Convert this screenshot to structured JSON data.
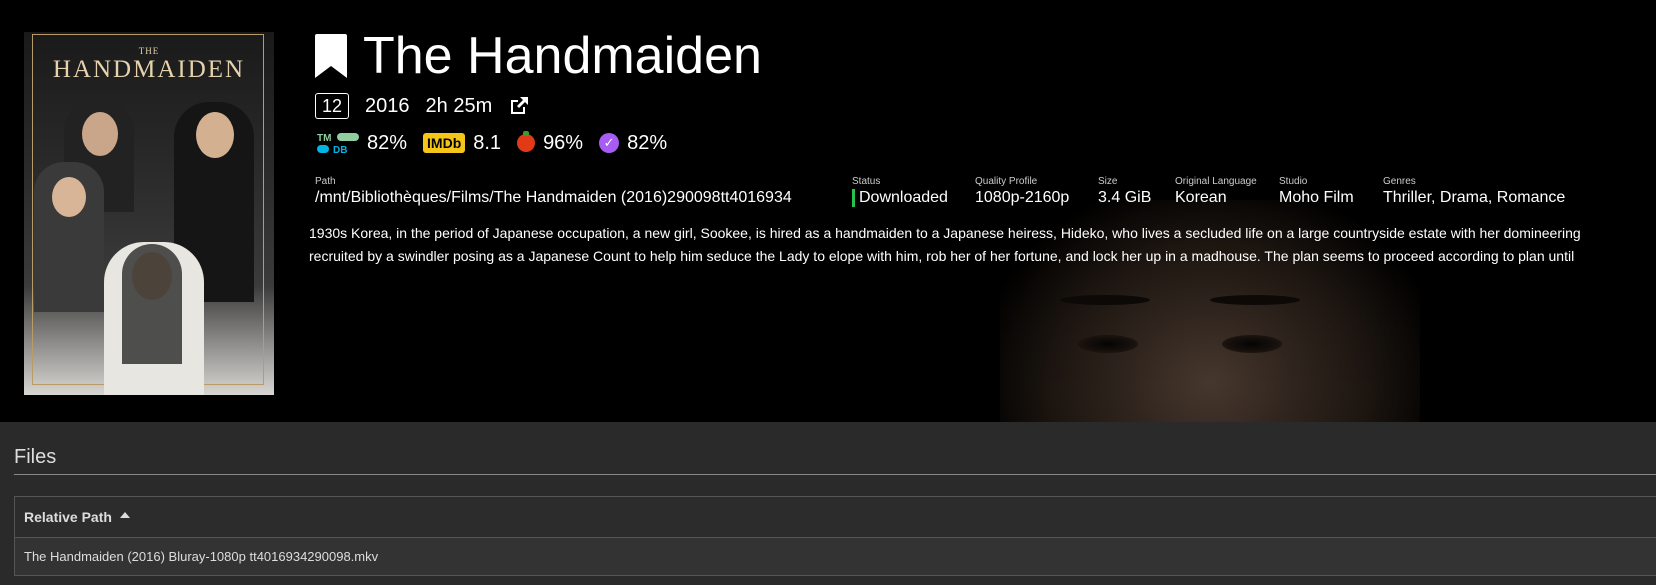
{
  "poster": {
    "small_title": "THE",
    "title": "HANDMAIDEN"
  },
  "movie": {
    "title": "The Handmaiden",
    "certification": "12",
    "year": "2016",
    "runtime": "2h 25m"
  },
  "ratings": {
    "tmdb_label": "TMDB",
    "tmdb": "82%",
    "imdb_label": "IMDb",
    "imdb": "8.1",
    "rotten": "96%",
    "trakt": "82%"
  },
  "details": {
    "path_label": "Path",
    "path": "/mnt/Bibliothèques/Films/The Handmaiden (2016)290098tt4016934",
    "status_label": "Status",
    "status": "Downloaded",
    "quality_label": "Quality Profile",
    "quality": "1080p-2160p",
    "size_label": "Size",
    "size": "3.4 GiB",
    "language_label": "Original Language",
    "language": "Korean",
    "studio_label": "Studio",
    "studio": "Moho Film",
    "genres_label": "Genres",
    "genres": "Thriller, Drama, Romance"
  },
  "overview": {
    "line1": "1930s Korea, in the period of Japanese occupation, a new girl, Sookee, is hired as a handmaiden to a Japanese heiress, Hideko, who lives a secluded life on a large countryside estate with her domineering",
    "line2": "recruited by a swindler posing as a Japanese Count to help him seduce the Lady to elope with him, rob her of her fortune, and lock her up in a madhouse. The plan seems to proceed according to plan until"
  },
  "files": {
    "title": "Files",
    "column_relative_path": "Relative Path",
    "rows": [
      {
        "relative_path": "The Handmaiden (2016) Bluray-1080p tt4016934290098.mkv"
      }
    ]
  },
  "colors": {
    "status_downloaded": "#27c24c",
    "imdb": "#f5c518",
    "tmdb": "#01b4e4",
    "trakt": "#a75cf2"
  }
}
